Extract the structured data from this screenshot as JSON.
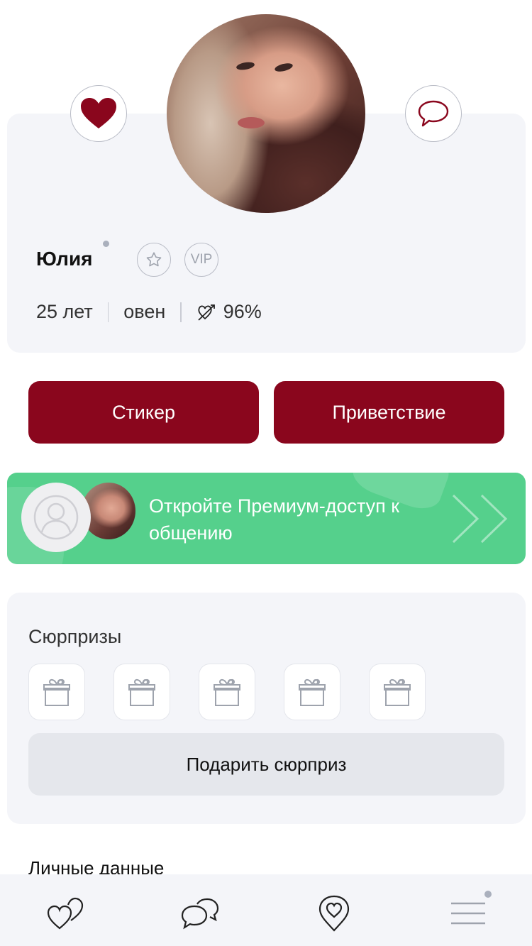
{
  "profile": {
    "name": "Юлия",
    "age": "25 лет",
    "zodiac": "овен",
    "compatibility": "96%",
    "vip_label": "VIP"
  },
  "actions": {
    "sticker_label": "Стикер",
    "greeting_label": "Приветствие"
  },
  "premium": {
    "text": "Откройте Премиум-доступ к общению"
  },
  "surprises": {
    "title": "Сюрпризы",
    "gift_button_label": "Подарить сюрприз",
    "slots": [
      "gift-icon",
      "gift-icon",
      "gift-icon",
      "gift-icon",
      "gift-icon"
    ]
  },
  "personal": {
    "title": "Личные данные"
  },
  "icons": {
    "like": "heart-icon",
    "chat": "chat-bubble-icon",
    "star": "star-icon",
    "compatibility": "heart-arrow-icon",
    "nav": [
      "hearts-icon",
      "chats-icon",
      "heart-pin-icon",
      "menu-icon"
    ]
  },
  "colors": {
    "brand": "#8a061d",
    "premium": "#55d08c",
    "card_bg": "#f4f5f9"
  }
}
